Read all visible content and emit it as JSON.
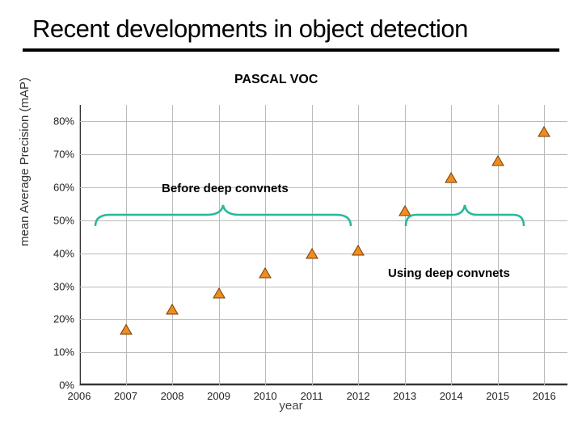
{
  "title": "Recent developments in object detection",
  "subtitle": "PASCAL VOC",
  "ylabel": "mean Average Precision (mAP)",
  "xlabel": "year",
  "annotations": {
    "before": "Before deep convnets",
    "using": "Using deep convnets"
  },
  "yticks": [
    "0%",
    "10%",
    "20%",
    "30%",
    "40%",
    "50%",
    "60%",
    "70%",
    "80%"
  ],
  "xticks": [
    "2006",
    "2007",
    "2008",
    "2009",
    "2010",
    "2011",
    "2012",
    "2013",
    "2014",
    "2015",
    "2016"
  ],
  "chart_data": {
    "type": "scatter",
    "xlabel": "year",
    "ylabel": "mean Average Precision (mAP)",
    "title": "PASCAL VOC",
    "x": [
      2007,
      2008,
      2009,
      2010,
      2011,
      2012,
      2013,
      2014,
      2015,
      2016
    ],
    "y": [
      17,
      23,
      28,
      34,
      40,
      41,
      53,
      63,
      68,
      77
    ],
    "xlim": [
      2006,
      2016.5
    ],
    "ylim": [
      0,
      85
    ],
    "series": [
      {
        "name": "mAP",
        "marker": "triangle",
        "color": "#ef8d22"
      }
    ],
    "annotations": [
      {
        "text": "Before deep convnets",
        "x_range": [
          2007,
          2012
        ]
      },
      {
        "text": "Using deep convnets",
        "x_range": [
          2013,
          2016
        ]
      }
    ]
  }
}
